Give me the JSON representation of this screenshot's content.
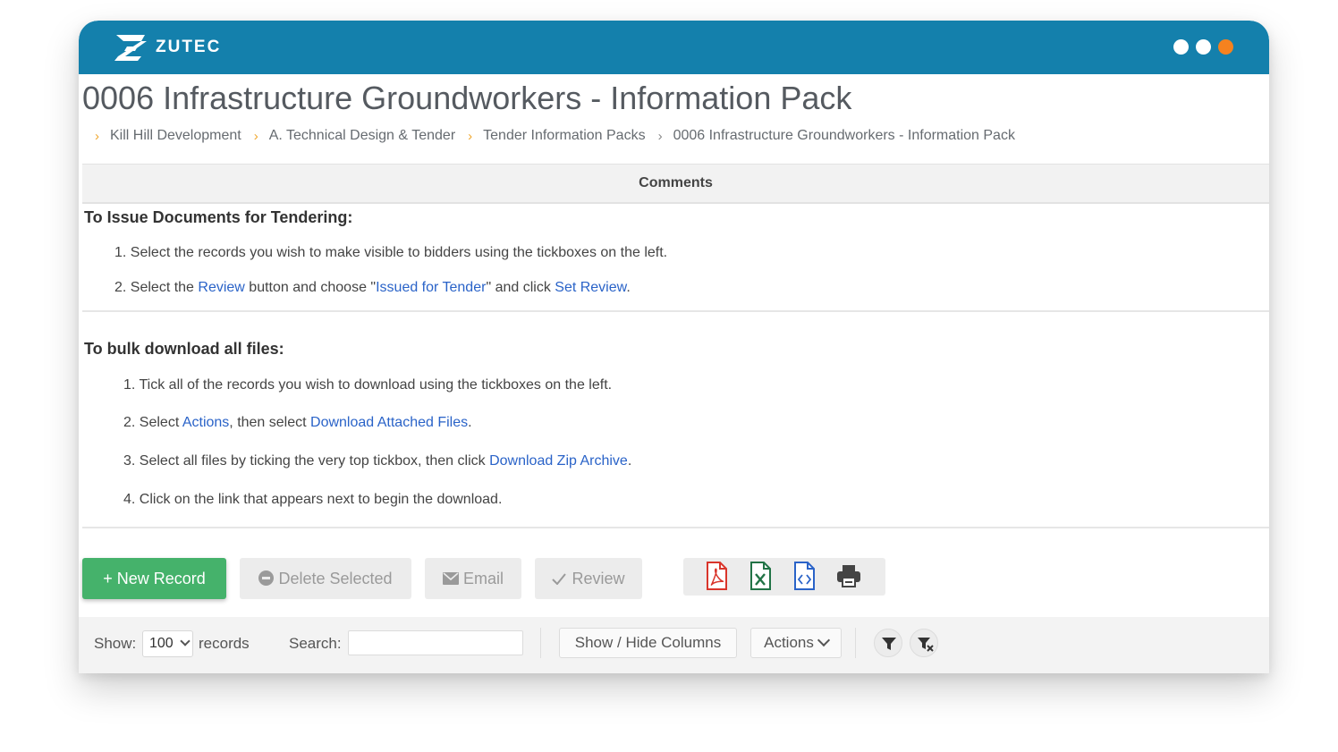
{
  "brand": {
    "name": "ZUTEC",
    "primary_color": "#1480ac",
    "accent_color": "#f5821f"
  },
  "page": {
    "title": "0006 Infrastructure Groundworkers - Information Pack"
  },
  "breadcrumb": [
    "Kill Hill Development",
    "A. Technical Design & Tender",
    "Tender Information Packs",
    "0006 Infrastructure Groundworkers - Information Pack"
  ],
  "comments": {
    "header": "Comments",
    "tendering": {
      "title": "To Issue Documents for Tendering:",
      "step1": "1. Select the records you wish to make visible to bidders using the tickboxes on the left.",
      "step2_pre": "2. Select the ",
      "step2_link1": "Review",
      "step2_mid1": " button and choose \"",
      "step2_link2": "Issued for Tender",
      "step2_mid2": "\" and click ",
      "step2_link3": "Set Review",
      "step2_end": "."
    },
    "bulk": {
      "title": "To bulk download all files:",
      "step1": "1. Tick all of the records you wish to download using the tickboxes on the left.",
      "step2_pre": "2. Select ",
      "step2_link1": "Actions",
      "step2_mid": ", then select ",
      "step2_link2": "Download Attached Files",
      "step2_end": ".",
      "step3_pre": "3. Select all files by ticking the very top tickbox, then click ",
      "step3_link": "Download Zip Archive",
      "step3_end": ".",
      "step4": "4. Click on the link that appears next to begin the download."
    }
  },
  "actions": {
    "new_record": "+ New Record",
    "delete_selected": "Delete Selected",
    "email": "Email",
    "review": "Review",
    "export_icons": [
      "pdf-icon",
      "excel-icon",
      "code-file-icon",
      "print-icon"
    ]
  },
  "toolbar": {
    "show_label": "Show:",
    "show_value": "100",
    "records_label": "records",
    "search_label": "Search:",
    "search_value": "",
    "show_hide_columns": "Show / Hide Columns",
    "actions_label": "Actions"
  }
}
